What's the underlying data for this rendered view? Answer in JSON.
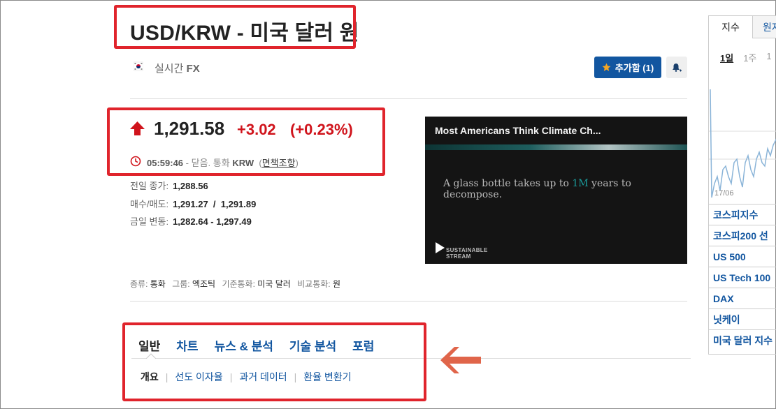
{
  "instrument": {
    "title": "USD/KRW - 미국 달러 원",
    "realtime_label": "실시간",
    "realtime_suffix": "FX"
  },
  "actions": {
    "follow_label": "추가함 (1)"
  },
  "quote": {
    "last": "1,291.58",
    "change": "+3.02",
    "change_pct": "(+0.23%)",
    "time": "05:59:46",
    "status": "- 닫음. 통화",
    "currency": "KRW",
    "disclaimer_open": "(",
    "disclaimer": "면책조항",
    "disclaimer_close": ")"
  },
  "stats": [
    {
      "label": "전일 종가:",
      "value": "1,288.56"
    },
    {
      "label": "매수/매도:",
      "value": "1,291.27  /  1,291.89"
    },
    {
      "label": "금일 변동:",
      "value": "1,282.64 - 1,297.49"
    }
  ],
  "meta": {
    "type_label": "종류:",
    "type_value": "통화",
    "group_label": "그룹:",
    "group_value": "엑조틱",
    "base_label": "기준통화:",
    "base_value": "미국 달러",
    "quote_label": "비교통화:",
    "quote_value": "원"
  },
  "video": {
    "title": "Most Americans Think Climate Ch...",
    "caption_before": "A glass bottle takes up to ",
    "caption_highlight": "1M",
    "caption_after": " years to decompose.",
    "brand_line1": "SUSTAINABLE",
    "brand_line2": "STREAM"
  },
  "tabs": [
    "일반",
    "차트",
    "뉴스 & 분석",
    "기술 분석",
    "포럼"
  ],
  "subtabs": [
    "개요",
    "선도 이자율",
    "과거 데이터",
    "환율 변환기"
  ],
  "right_panel": {
    "tab_active": "지수",
    "tab_other": "원자",
    "ranges": [
      "1일",
      "1주",
      "1"
    ],
    "date_label": "17/06",
    "items": [
      "코스피지수",
      "코스피200 선",
      "US 500",
      "US Tech 100",
      "DAX",
      "닛케이",
      "미국 달러 지수"
    ]
  },
  "colors": {
    "annotation_red": "#e0242c",
    "brand_blue": "#1256a0",
    "up_red": "#d0141c",
    "arrow_orange": "#e0654a"
  }
}
